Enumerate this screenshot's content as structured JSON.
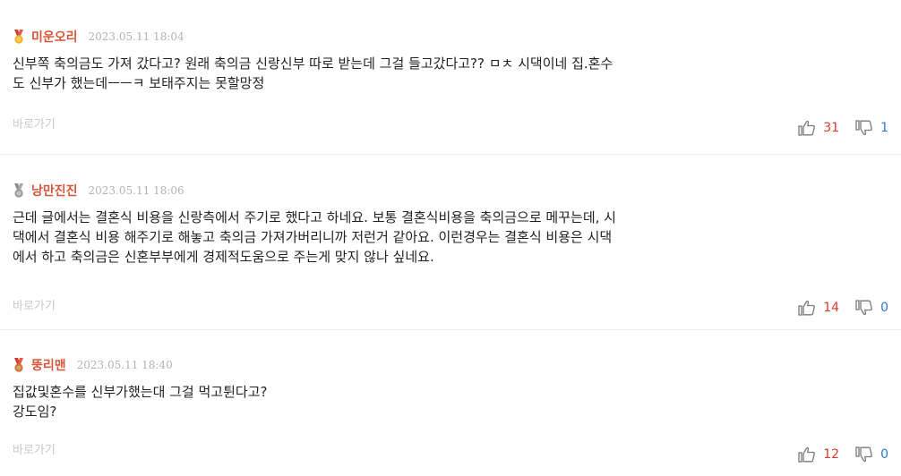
{
  "comments": [
    {
      "rank_medal": "gold-medal-icon",
      "nickname": "미운오리",
      "timestamp": "2023.05.11 18:04",
      "text": "신부쪽 축의금도 가져 갔다고? 원래 축의금 신랑신부 따로 받는데 그걸 들고갔다고?? ㅁㅊ 시댁이네 집.혼수\n도 신부가 했는데ㅡㅡㅋ 보태주지는 못할망정",
      "shortcut_label": "바로가기",
      "likes": "31",
      "dislikes": "1"
    },
    {
      "rank_medal": "silver-medal-icon",
      "nickname": "낭만진진",
      "timestamp": "2023.05.11 18:06",
      "text": "근데 글에서는 결혼식 비용을 신랑측에서 주기로 했다고 하네요. 보통 결혼식비용을 축의금으로 메꾸는데, 시\n댁에서 결혼식 비용 해주기로 해놓고 축의금 가져가버리니까 저런거 같아요. 이런경우는 결혼식 비용은 시댁\n에서 하고 축의금은 신혼부부에게 경제적도움으로 주는게 맞지 않나 싶네요.",
      "shortcut_label": "바로가기",
      "likes": "14",
      "dislikes": "0"
    },
    {
      "rank_medal": "bronze-medal-icon",
      "nickname": "뚱리맨",
      "timestamp": "2023.05.11 18:40",
      "text": "집값및혼수를 신부가했는대 그걸 먹고튄다고?\n강도임?",
      "shortcut_label": "바로가기",
      "likes": "12",
      "dislikes": "0"
    }
  ],
  "colors": {
    "nickname": "#d6563a",
    "like_count": "#e03a2e",
    "dislike_count": "#2a78d6",
    "gold": "#f2b01e",
    "silver": "#9a9a9a",
    "bronze": "#c8763a",
    "ribbon": "#d33b2f"
  }
}
